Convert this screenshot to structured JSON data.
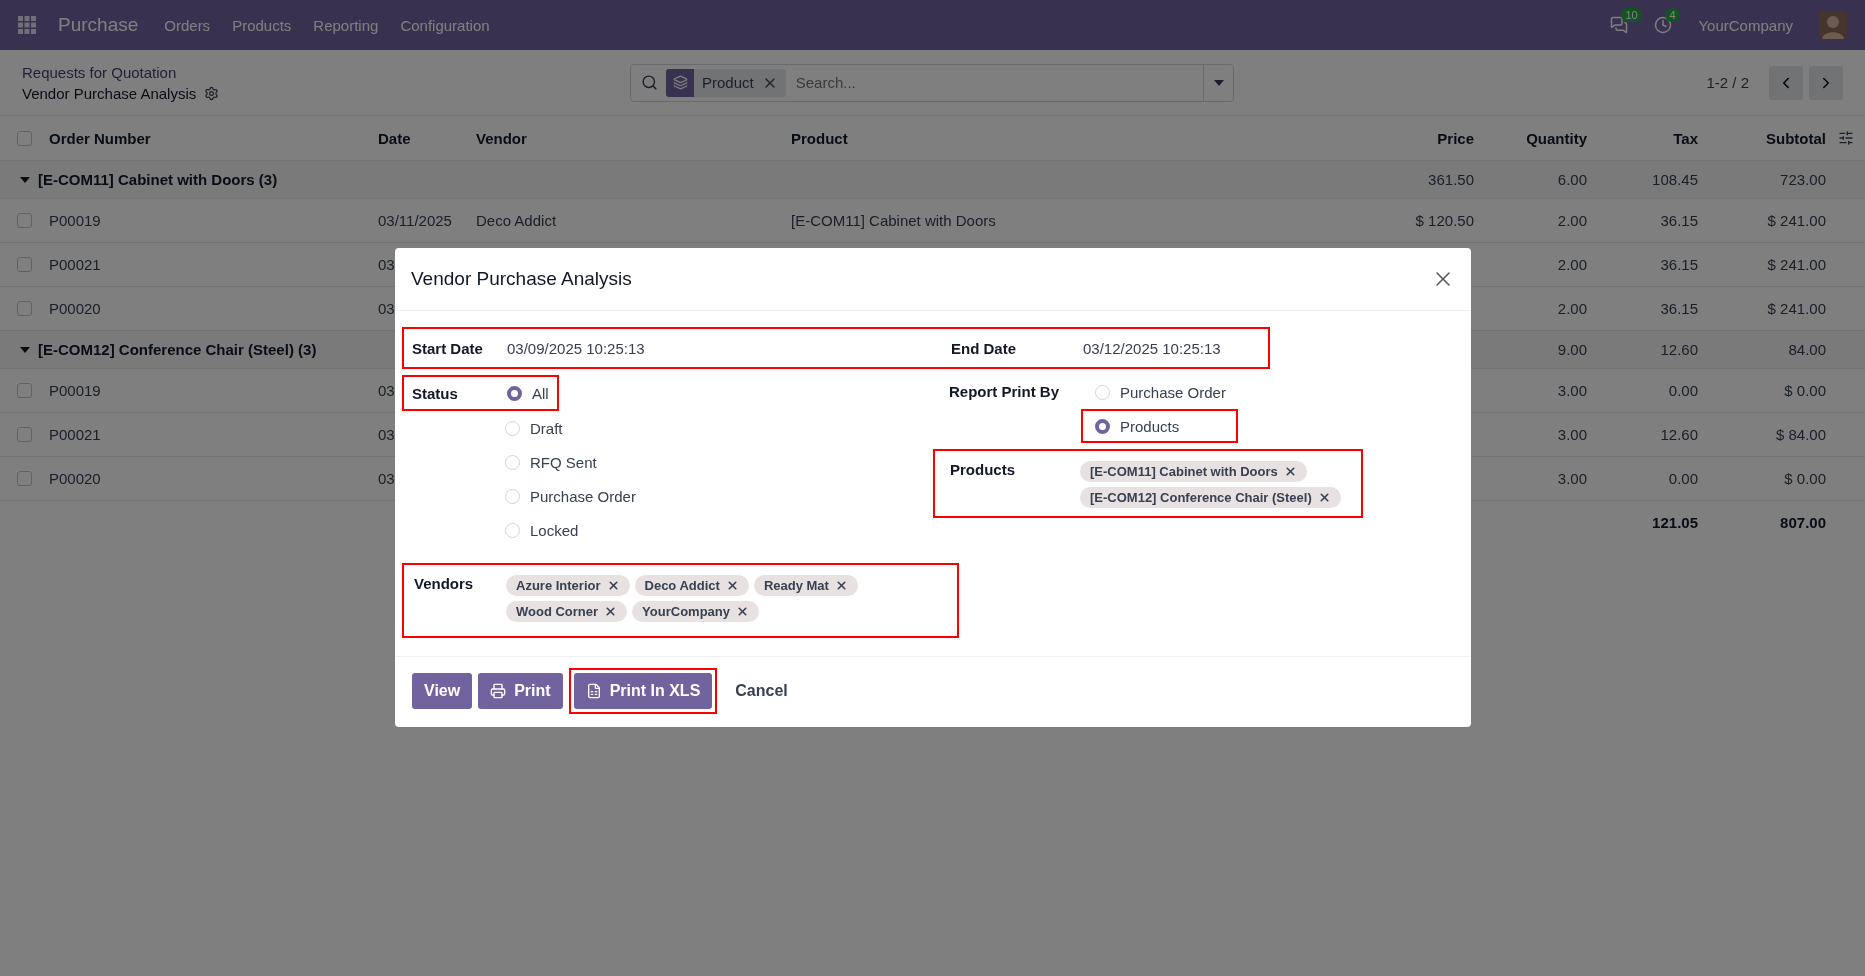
{
  "navbar": {
    "app": "Purchase",
    "menu": [
      "Orders",
      "Products",
      "Reporting",
      "Configuration"
    ],
    "messages_badge": "10",
    "activities_badge": "4",
    "company": "YourCompany"
  },
  "breadcrumb": {
    "parent": "Requests for Quotation",
    "current": "Vendor Purchase Analysis"
  },
  "search": {
    "facet": "Product",
    "placeholder": "Search..."
  },
  "pager": "1-2 / 2",
  "table": {
    "select_all_checked": false,
    "columns": [
      "Order Number",
      "Date",
      "Vendor",
      "Product",
      "Price",
      "Quantity",
      "Tax",
      "Subtotal"
    ],
    "rows": [
      {
        "kind": "group",
        "expanded": true,
        "label": "[E-COM11] Cabinet with Doors (3)",
        "price": "361.50",
        "quantity": "6.00",
        "tax": "108.45",
        "subtotal": "723.00"
      },
      {
        "kind": "record",
        "checked": false,
        "order": "P00019",
        "date": "03/11/2025",
        "vendor": "Deco Addict",
        "product": "[E-COM11] Cabinet with Doors",
        "price": "$ 120.50",
        "quantity": "2.00",
        "tax": "36.15",
        "subtotal": "$ 241.00"
      },
      {
        "kind": "record",
        "checked": false,
        "order": "P00021",
        "date": "03",
        "quantity": "2.00",
        "tax": "36.15",
        "subtotal": "$ 241.00"
      },
      {
        "kind": "record",
        "checked": false,
        "order": "P00020",
        "date": "03",
        "quantity": "2.00",
        "tax": "36.15",
        "subtotal": "$ 241.00"
      },
      {
        "kind": "group",
        "expanded": true,
        "label": "[E-COM12] Conference Chair (Steel) (3)",
        "quantity": "9.00",
        "tax": "12.60",
        "subtotal": "84.00"
      },
      {
        "kind": "record",
        "checked": false,
        "order": "P00019",
        "date": "03",
        "quantity": "3.00",
        "tax": "0.00",
        "subtotal": "$ 0.00"
      },
      {
        "kind": "record",
        "checked": false,
        "order": "P00021",
        "date": "03",
        "quantity": "3.00",
        "tax": "12.60",
        "subtotal": "$ 84.00"
      },
      {
        "kind": "record",
        "checked": false,
        "order": "P00020",
        "date": "03",
        "quantity": "3.00",
        "tax": "0.00",
        "subtotal": "$ 0.00"
      }
    ],
    "totals": {
      "tax": "121.05",
      "subtotal": "807.00"
    }
  },
  "modal": {
    "title": "Vendor Purchase Analysis",
    "date_range": {
      "highlighted": true,
      "start": {
        "label": "Start Date",
        "value": "03/09/2025 10:25:13"
      },
      "end": {
        "label": "End Date",
        "value": "03/12/2025 10:25:13"
      }
    },
    "status": {
      "label": "Status",
      "highlighted": true,
      "options": [
        {
          "label": "All",
          "selected": true
        },
        {
          "label": "Draft",
          "selected": false
        },
        {
          "label": "RFQ Sent",
          "selected": false
        },
        {
          "label": "Purchase Order",
          "selected": false
        },
        {
          "label": "Locked",
          "selected": false
        }
      ]
    },
    "report_print_by": {
      "label": "Report Print By",
      "options": [
        {
          "label": "Purchase Order",
          "selected": false,
          "highlighted": false
        },
        {
          "label": "Products",
          "selected": true,
          "highlighted": true
        }
      ]
    },
    "products": {
      "label": "Products",
      "highlighted": true,
      "tags": [
        "[E-COM11] Cabinet with Doors",
        "[E-COM12] Conference Chair (Steel)"
      ]
    },
    "vendors": {
      "label": "Vendors",
      "highlighted": true,
      "tags": [
        "Azure Interior",
        "Deco Addict",
        "Ready Mat",
        "Wood Corner",
        "YourCompany"
      ]
    },
    "buttons": [
      {
        "label": "View",
        "kind": "plain",
        "highlighted": false
      },
      {
        "label": "Print",
        "kind": "print",
        "highlighted": false
      },
      {
        "label": "Print In XLS",
        "kind": "xls",
        "highlighted": true
      },
      {
        "label": "Cancel",
        "kind": "link",
        "highlighted": false
      }
    ]
  }
}
